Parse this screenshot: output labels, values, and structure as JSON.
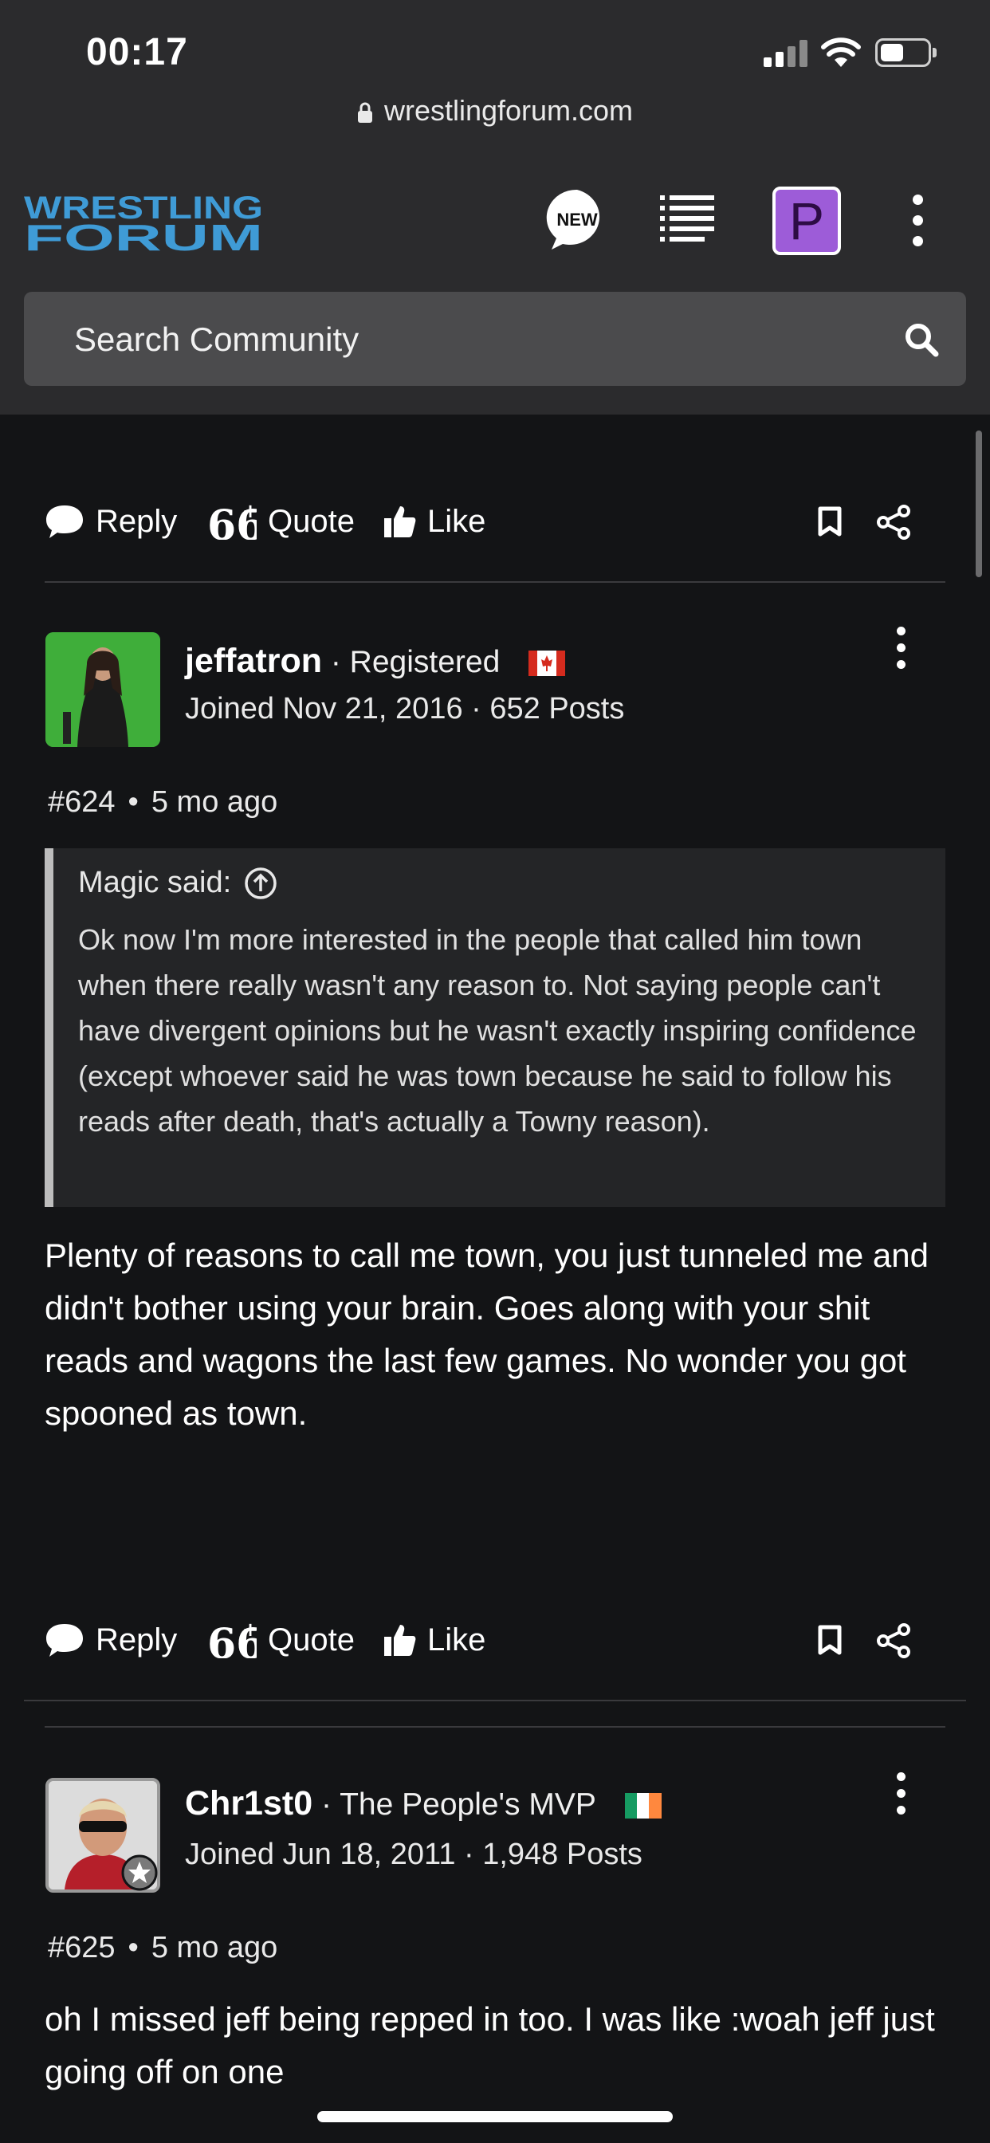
{
  "status_bar": {
    "time": "00:17"
  },
  "browser": {
    "url": "wrestlingforum.com"
  },
  "header": {
    "logo_line1": "WRESTLING",
    "logo_line2": "FORUM",
    "new_badge": "NEW",
    "profile_letter": "P",
    "search_placeholder": "Search Community"
  },
  "actions": {
    "reply": "Reply",
    "quote": "Quote",
    "like": "Like"
  },
  "posts": [
    {
      "username": "jeffatron",
      "rank": " · Registered",
      "joined": "Joined Nov 21, 2016 · 652 Posts",
      "number": "#624",
      "age": "5 mo ago",
      "flag": "canada",
      "quote": {
        "author": "Magic said:",
        "text": "Ok now I'm more interested in the people that called him town when there really wasn't any reason to. Not saying people can't have divergent opinions but he wasn't exactly inspiring confidence (except whoever said he was town because he said to follow his reads after death, that's actually a Towny reason)."
      },
      "body": "Plenty of reasons to call me town, you just tunneled me and didn't bother using your brain. Goes along with your shit reads and wagons the last few games. No wonder you got spooned as town."
    },
    {
      "username": "Chr1st0",
      "rank": " · The People's MVP",
      "joined": "Joined Jun 18, 2011 · 1,948 Posts",
      "number": "#625",
      "age": "5 mo ago",
      "flag": "ireland",
      "body": "oh I missed jeff being repped in too. I was like :woah jeff just going off on one"
    }
  ],
  "colors": {
    "background": "#131416",
    "header": "#2b2b2d",
    "search": "#4b4b4d",
    "logo": "#3f9bd6",
    "profile": "#9d5cd8"
  }
}
